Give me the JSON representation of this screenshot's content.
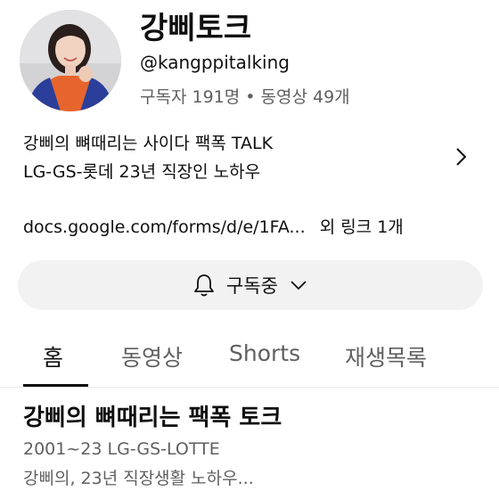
{
  "channel": {
    "name": "강삐토크",
    "handle": "@kangppitalking",
    "stats": "구독자 191명 • 동영상 49개"
  },
  "description": {
    "line1": "강삐의 뼈때리는 사이다 팩폭 TALK",
    "line2": "LG-GS-롯데 23년 직장인 노하우",
    "more_icon": "chevron-right-icon"
  },
  "links": {
    "url": "docs.google.com/forms/d/e/1FA...",
    "more": "외 링크 1개"
  },
  "subscribe": {
    "icon": "bell-icon",
    "label": "구독중",
    "dropdown_icon": "chevron-down-icon"
  },
  "tabs": [
    {
      "label": "홈",
      "active": true
    },
    {
      "label": "동영상",
      "active": false
    },
    {
      "label": "Shorts",
      "active": false
    },
    {
      "label": "재생목록",
      "active": false
    }
  ],
  "featured": {
    "title": "강삐의 뼈때리는 팩폭 토크",
    "line1": "2001~23 LG-GS-LOTTE",
    "line2": "강삐의, 23년 직장생활 노하우..."
  }
}
